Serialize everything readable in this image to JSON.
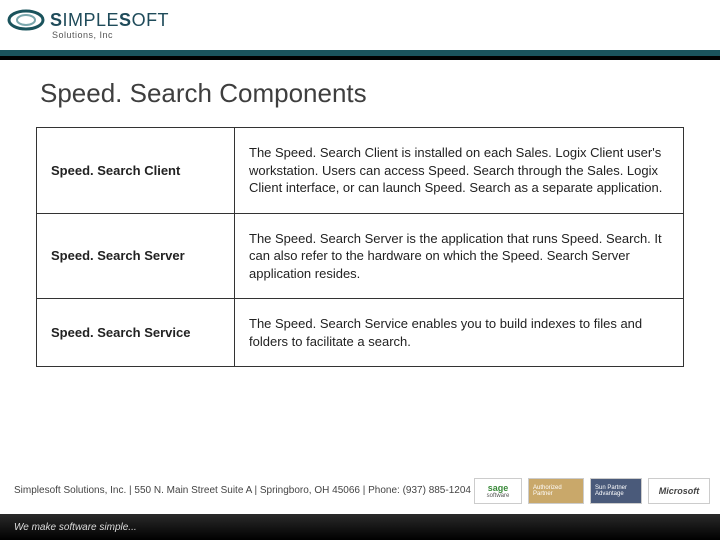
{
  "brand": {
    "name_prefix": "S",
    "name_mid": "IMPLE",
    "name_suffix": "S",
    "name_end": "OFT",
    "subline": "Solutions, Inc"
  },
  "title": "Speed. Search Components",
  "rows": [
    {
      "name": "Speed. Search Client",
      "desc": "The Speed. Search Client is installed on each Sales. Logix Client user's workstation. Users can access Speed. Search through the Sales. Logix Client interface, or can launch Speed. Search as a separate application."
    },
    {
      "name": "Speed. Search Server",
      "desc": "The Speed. Search Server is the application that runs Speed. Search. It can also refer to the hardware on which the Speed. Search Server application resides."
    },
    {
      "name": "Speed. Search Service",
      "desc": "The Speed. Search Service enables you to build indexes to files and folders to facilitate a search."
    }
  ],
  "footer": "Simplesoft Solutions, Inc.  |  550 N. Main Street Suite A  |  Springboro, OH 45066  |  Phone: (937) 885-1204",
  "tagline": "We make software simple...",
  "partners": {
    "sage": "sage",
    "sage_sub": "software",
    "auth": "Authorized Partner",
    "sun": "Sun Partner Advantage",
    "ms": "Microsoft"
  }
}
